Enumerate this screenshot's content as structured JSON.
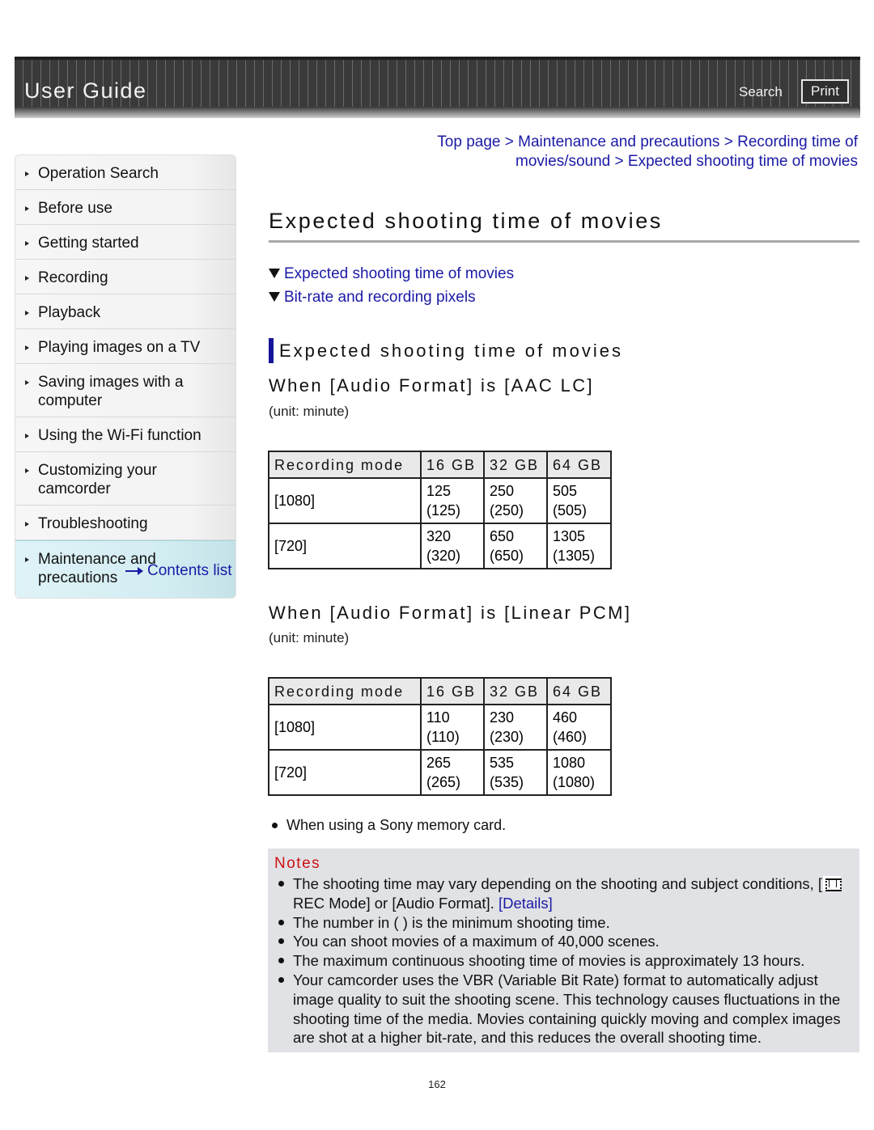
{
  "header": {
    "title": "User Guide",
    "search_label": "Search",
    "print_label": "Print"
  },
  "sidebar": {
    "items": [
      {
        "label": "Operation Search",
        "active": false
      },
      {
        "label": "Before use",
        "active": false
      },
      {
        "label": "Getting started",
        "active": false
      },
      {
        "label": "Recording",
        "active": false
      },
      {
        "label": "Playback",
        "active": false
      },
      {
        "label": "Playing images on a TV",
        "active": false
      },
      {
        "label": "Saving images with a computer",
        "active": false
      },
      {
        "label": "Using the Wi-Fi function",
        "active": false
      },
      {
        "label": "Customizing your camcorder",
        "active": false
      },
      {
        "label": "Troubleshooting",
        "active": false
      },
      {
        "label": "Maintenance and precautions",
        "active": true
      }
    ],
    "contents_link": "Contents list"
  },
  "breadcrumb": {
    "items": [
      "Top page",
      "Maintenance and precautions",
      "Recording time of movies/sound",
      "Expected shooting time of movies"
    ],
    "separator": ">"
  },
  "main": {
    "title": "Expected shooting time of movies",
    "toc": [
      "Expected shooting time of movies",
      "Bit-rate and recording pixels"
    ],
    "section_title": "Expected shooting time of movies",
    "tables": [
      {
        "heading": "When [Audio Format] is [AAC LC]",
        "unit": "(unit: minute)",
        "columns": [
          "Recording mode",
          "16 GB",
          "32 GB",
          "64 GB"
        ],
        "rows": [
          {
            "mode": "[1080]",
            "values": [
              [
                "125",
                "(125)"
              ],
              [
                "250",
                "(250)"
              ],
              [
                "505",
                "(505)"
              ]
            ]
          },
          {
            "mode": "[720]",
            "values": [
              [
                "320",
                "(320)"
              ],
              [
                "650",
                "(650)"
              ],
              [
                "1305",
                "(1305)"
              ]
            ]
          }
        ]
      },
      {
        "heading": "When [Audio Format] is [Linear PCM]",
        "unit": "(unit: minute)",
        "columns": [
          "Recording mode",
          "16 GB",
          "32 GB",
          "64 GB"
        ],
        "rows": [
          {
            "mode": "[1080]",
            "values": [
              [
                "110",
                "(110)"
              ],
              [
                "230",
                "(230)"
              ],
              [
                "460",
                "(460)"
              ]
            ]
          },
          {
            "mode": "[720]",
            "values": [
              [
                "265",
                "(265)"
              ],
              [
                "535",
                "(535)"
              ],
              [
                "1080",
                "(1080)"
              ]
            ]
          }
        ]
      }
    ],
    "footnote": "When using a Sony memory card.",
    "notes": {
      "title": "Notes",
      "note1_text_a": "The shooting time may vary depending on the shooting and subject conditions, [",
      "note1_icon": "movie-film-icon",
      "note1_text_b": "REC Mode] or [Audio Format]. ",
      "note1_link": "[Details]",
      "items": [
        "The number in ( ) is the minimum shooting time.",
        "You can shoot movies of a maximum of 40,000 scenes.",
        "The maximum continuous shooting time of movies is approximately 13 hours.",
        "Your camcorder uses the VBR (Variable Bit Rate) format to automatically adjust image quality to suit the shooting scene. This technology causes fluctuations in the shooting time of the media. Movies containing quickly moving and complex images are shot at a higher bit-rate, and this reduces the overall shooting time."
      ]
    }
  },
  "page_number": "162",
  "colors": {
    "link": "#1a1aa6",
    "notes_title": "#cc1111",
    "section_bar": "#151596",
    "notes_bg": "#e1e2e6",
    "active_nav_bg": "#d2edf2"
  }
}
